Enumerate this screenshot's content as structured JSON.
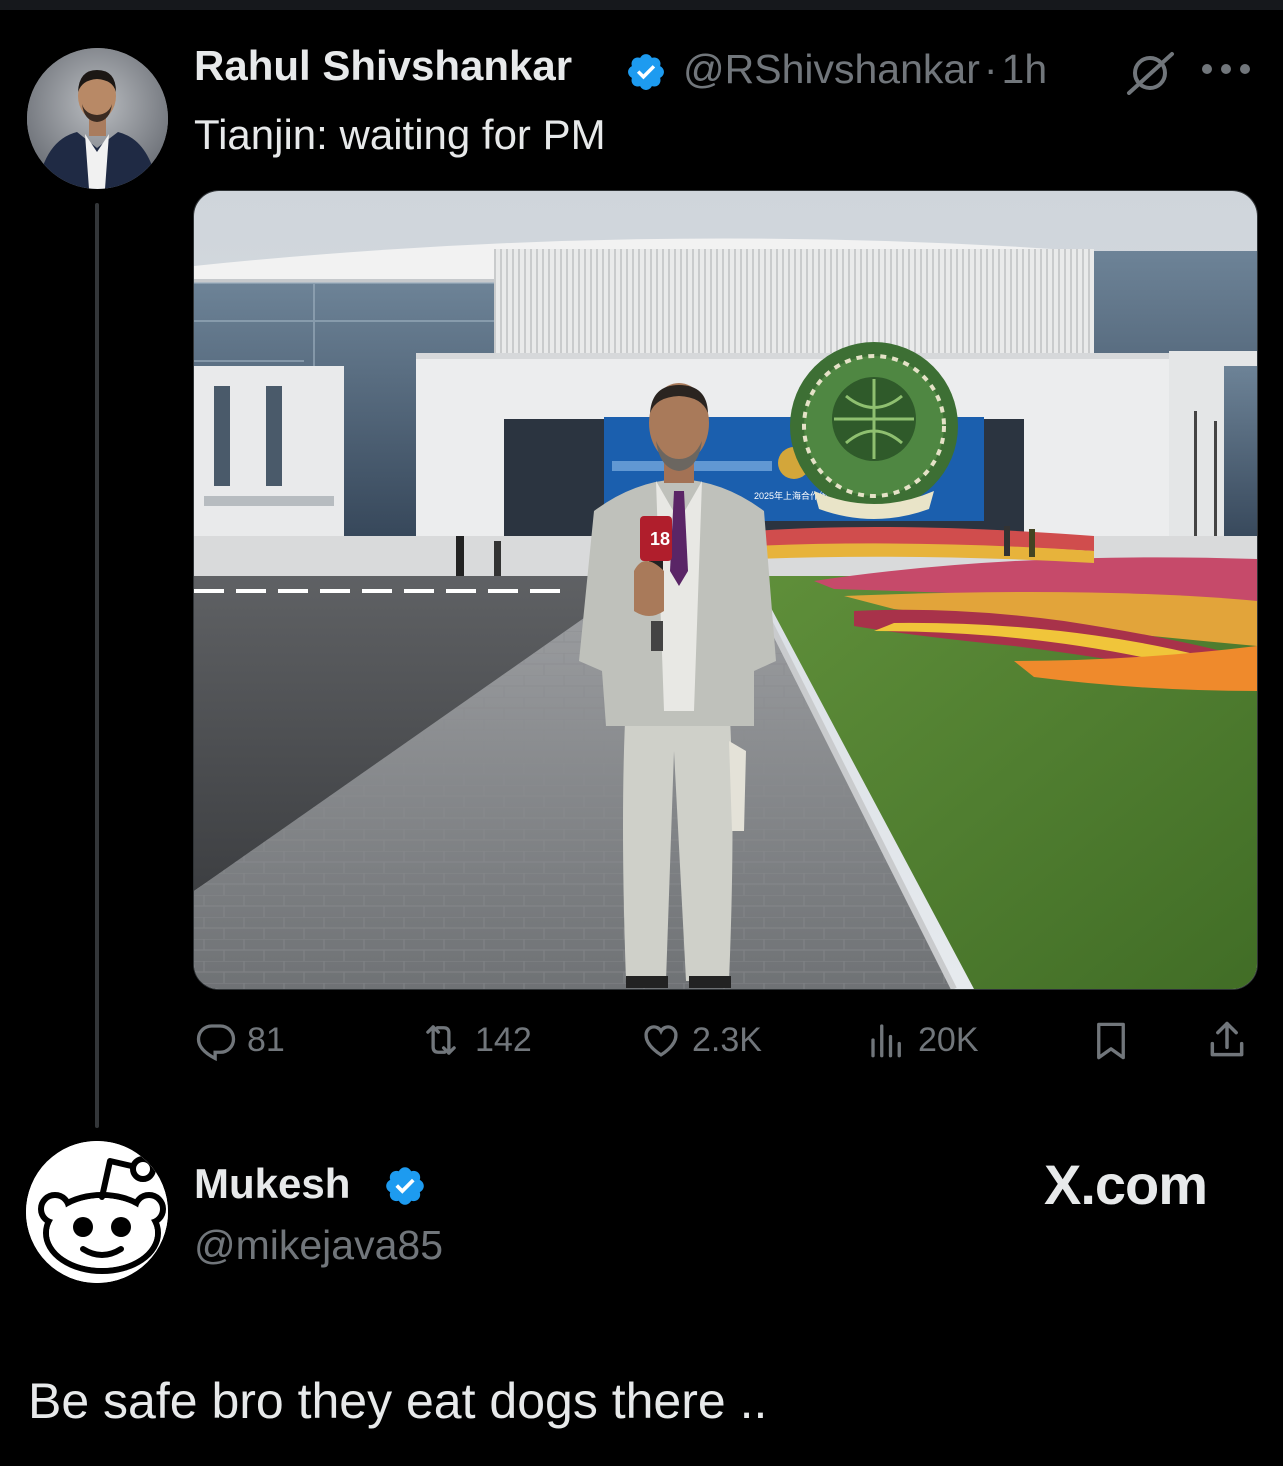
{
  "tweet": {
    "author_name": "Rahul Shivshankar",
    "handle": "@RShivshankar",
    "separator": "·",
    "time": "1h",
    "text": "Tianjin: waiting for PM",
    "media": {
      "banner_text": "2025年上海合作组织",
      "mic_label": "18"
    },
    "actions": {
      "replies": "81",
      "retweets": "142",
      "likes": "2.3K",
      "views": "20K"
    }
  },
  "reply": {
    "author_name": "Mukesh",
    "handle": "@mikejava85",
    "text": "Be safe bro they eat dogs there .."
  },
  "watermark": "X.com",
  "icons": [
    "verified-badge-icon",
    "grok-icon",
    "more-icon",
    "reply-icon",
    "retweet-icon",
    "like-icon",
    "views-icon",
    "bookmark-icon",
    "share-icon"
  ],
  "colors": {
    "background": "#000000",
    "text": "#e7e9ea",
    "muted": "#71767b",
    "verified": "#1d9bf0"
  }
}
